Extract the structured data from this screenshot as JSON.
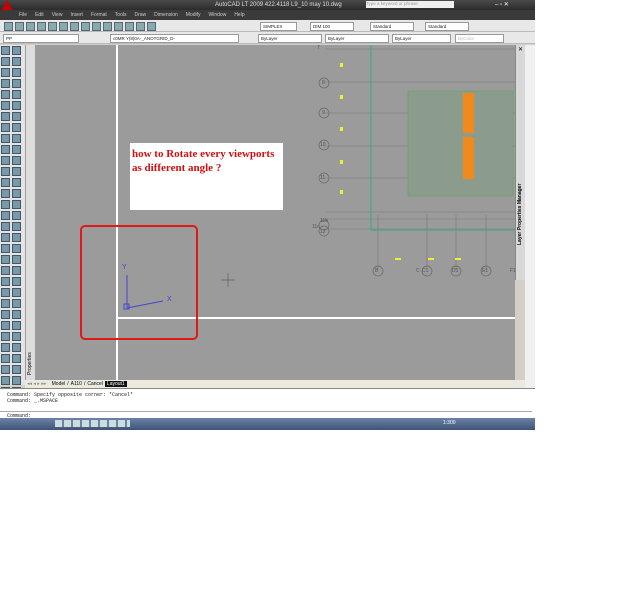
{
  "title": "AutoCAD LT 2009  422.4118 L9_10 may 10.dwg",
  "search_placeholder": "Type a keyword or phrase",
  "menu": [
    "File",
    "Edit",
    "View",
    "Insert",
    "Format",
    "Tools",
    "Draw",
    "Dimension",
    "Modify",
    "Window",
    "Help"
  ],
  "toolbar": {
    "text_style": "SIMPLEX",
    "dim_style": "DIM 100",
    "table_style": "Standard",
    "mleader_style": "Standard",
    "workspace": "PP",
    "layer": "c0MR Y(8)0A-_ANOTGRID_D-",
    "color": "ByLayer",
    "linetype": "ByLayer",
    "lineweight": "ByLayer",
    "plotstyle": "ByColor"
  },
  "palettes": {
    "properties": "Properties",
    "layer_manager": "Layer Properties Manager"
  },
  "drawing": {
    "grid_rows": [
      "7",
      "8",
      "9",
      "10",
      "11",
      "11b",
      "11c",
      "12"
    ],
    "grid_cols": [
      "B",
      "C",
      "C1",
      "D1",
      "E1",
      "F1"
    ],
    "ucs_x": "X",
    "ucs_y": "Y"
  },
  "annotation": "how to Rotate every viewports as different angle ?",
  "tabs": [
    "Model",
    "A110",
    "Cancel",
    "Layout1"
  ],
  "command": {
    "line1": "Command: Specify opposite corner: *Cancel*",
    "line2": "Command: _.MSPACE",
    "prompt": "Command:"
  },
  "status": {
    "scale": "1:300"
  }
}
